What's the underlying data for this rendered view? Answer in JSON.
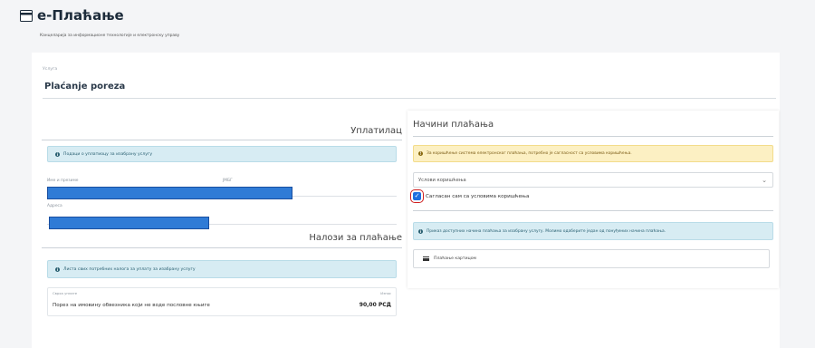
{
  "header": {
    "app_title": "е-Плаћање",
    "subtitle": "Канцеларија за информационе технологије и електронску управу"
  },
  "breadcrumb": "Услуга",
  "page_title": "Plaćanje poreza",
  "left": {
    "payer_heading": "Уплатилац",
    "payer_info": "Подаци о уплатиоцу за изабрану услугу",
    "name_label": "Име и презиме",
    "jmbg_label": "ЈМБГ",
    "address_label": "Адреса",
    "orders_heading": "Налози за плаћање",
    "orders_info": "Листа свих потребних налога за уплату за изабрану услугу",
    "order_col_purpose": "Сврха уплате",
    "order_col_amount": "Износ",
    "order_description": "Порез на имовину обвезника који не воде пословне књиге",
    "order_amount": "90,00 РСД"
  },
  "right": {
    "heading": "Начини плаћања",
    "warning": "За коришћење система електронског плаћања, потребно је сагласност са условима коришћења.",
    "terms_select": "Услови коришћења",
    "agree_label": "Сагласан сам са условима коришћења",
    "agree_checked": true,
    "methods_info": "Приказ доступних начина плаћања за изабрану услугу. Молимо одаберите један од понуђених начина плаћања.",
    "card_payment": "Плаћање картицом"
  },
  "colors": {
    "redaction": "#2f7bd6",
    "info_bg": "#d7ecf3",
    "warning_bg": "#fcf0c3",
    "checkbox": "#1e6fe0",
    "highlight_ring": "#d02020"
  }
}
